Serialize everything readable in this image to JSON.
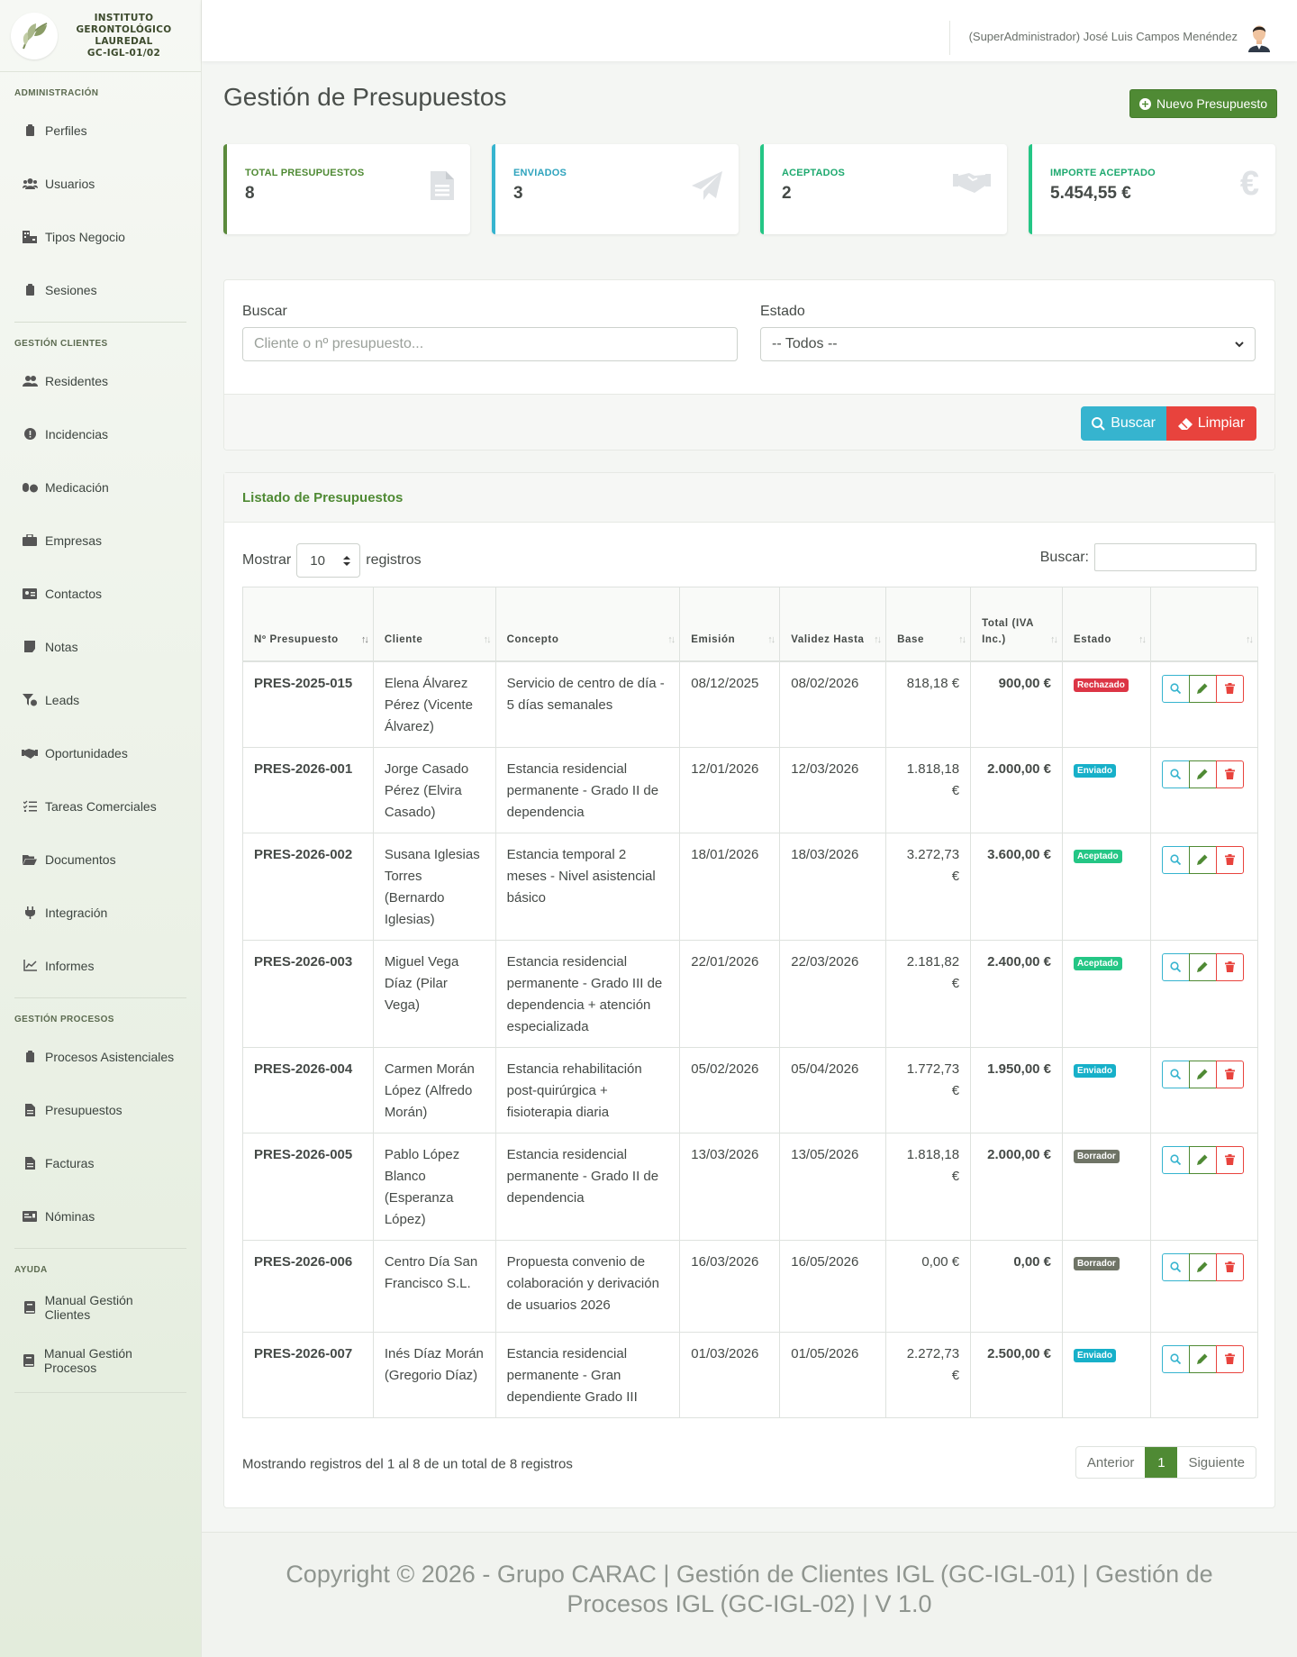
{
  "brand": {
    "line1": "INSTITUTO",
    "line2": "GERONTOLÓGICO",
    "line3": "LAUREDAL",
    "line4": "GC-IGL-01/02"
  },
  "sidebar": {
    "sections": [
      {
        "title": "Administración",
        "items": [
          "Perfiles",
          "Usuarios",
          "Tipos Negocio",
          "Sesiones"
        ]
      },
      {
        "title": "Gestión Clientes",
        "items": [
          "Residentes",
          "Incidencias",
          "Medicación",
          "Empresas",
          "Contactos",
          "Notas",
          "Leads",
          "Oportunidades",
          "Tareas Comerciales",
          "Documentos",
          "Integración",
          "Informes"
        ]
      },
      {
        "title": "Gestión Procesos",
        "items": [
          "Procesos Asistenciales",
          "Presupuestos",
          "Facturas",
          "Nóminas"
        ]
      },
      {
        "title": "Ayuda",
        "items": [
          "Manual Gestión Clientes",
          "Manual Gestión Procesos"
        ]
      }
    ]
  },
  "topbar": {
    "user": "(SuperAdministrador) José Luis Campos Menéndez"
  },
  "page": {
    "title": "Gestión de Presupuestos",
    "new_button": "Nuevo Presupuesto"
  },
  "stats": [
    {
      "label": "Total Presupuestos",
      "value": "8",
      "color": "#5b8a3c",
      "icon": "document-icon"
    },
    {
      "label": "Enviados",
      "value": "3",
      "color": "#36b4cf",
      "icon": "paper-plane-icon"
    },
    {
      "label": "Aceptados",
      "value": "2",
      "color": "#24c685",
      "icon": "handshake-icon"
    },
    {
      "label": "Importe Aceptado",
      "value": "5.454,55 €",
      "color": "#24c685",
      "icon": "euro-icon"
    }
  ],
  "filters": {
    "search_label": "Buscar",
    "search_placeholder": "Cliente o nº presupuesto...",
    "status_label": "Estado",
    "status_value": "-- Todos --",
    "search_button": "Buscar",
    "clear_button": "Limpiar"
  },
  "list": {
    "title": "Listado de Presupuestos",
    "show_label": "Mostrar",
    "page_size": "10",
    "records_label": "registros",
    "search_label": "Buscar:",
    "columns": [
      "Nº Presupuesto",
      "Cliente",
      "Concepto",
      "Emisión",
      "Validez Hasta",
      "Base",
      "Total (IVA Inc.)",
      "Estado"
    ],
    "rows": [
      {
        "num": "PRES-2025-015",
        "client": "Elena Álvarez Pérez (Vicente Álvarez)",
        "concept": "Servicio de centro de día - 5 días semanales",
        "issued": "08/12/2025",
        "valid": "08/02/2026",
        "base": "818,18 €",
        "total": "900,00 €",
        "status": "Rechazado",
        "status_color": "#dc3545"
      },
      {
        "num": "PRES-2026-001",
        "client": "Jorge Casado Pérez (Elvira Casado)",
        "concept": "Estancia residencial permanente - Grado II de dependencia",
        "issued": "12/01/2026",
        "valid": "12/03/2026",
        "base": "1.818,18 €",
        "total": "2.000,00 €",
        "status": "Enviado",
        "status_color": "#17b0c9"
      },
      {
        "num": "PRES-2026-002",
        "client": "Susana Iglesias Torres (Bernardo Iglesias)",
        "concept": "Estancia temporal 2 meses - Nivel asistencial básico",
        "issued": "18/01/2026",
        "valid": "18/03/2026",
        "base": "3.272,73 €",
        "total": "3.600,00 €",
        "status": "Aceptado",
        "status_color": "#24c685"
      },
      {
        "num": "PRES-2026-003",
        "client": "Miguel Vega Díaz (Pilar Vega)",
        "concept": "Estancia residencial permanente - Grado III de dependencia + atención especializada",
        "issued": "22/01/2026",
        "valid": "22/03/2026",
        "base": "2.181,82 €",
        "total": "2.400,00 €",
        "status": "Aceptado",
        "status_color": "#24c685"
      },
      {
        "num": "PRES-2026-004",
        "client": "Carmen Morán López (Alfredo Morán)",
        "concept": "Estancia rehabilitación post-quirúrgica + fisioterapia diaria",
        "issued": "05/02/2026",
        "valid": "05/04/2026",
        "base": "1.772,73 €",
        "total": "1.950,00 €",
        "status": "Enviado",
        "status_color": "#17b0c9"
      },
      {
        "num": "PRES-2026-005",
        "client": "Pablo López Blanco (Esperanza López)",
        "concept": "Estancia residencial permanente - Grado II de dependencia",
        "issued": "13/03/2026",
        "valid": "13/05/2026",
        "base": "1.818,18 €",
        "total": "2.000,00 €",
        "status": "Borrador",
        "status_color": "#6f7466"
      },
      {
        "num": "PRES-2026-006",
        "client": "Centro Día San Francisco S.L.",
        "concept": "Propuesta convenio de colaboración y derivación de usuarios 2026",
        "issued": "16/03/2026",
        "valid": "16/05/2026",
        "base": "0,00 €",
        "total": "0,00 €",
        "status": "Borrador",
        "status_color": "#6f7466"
      },
      {
        "num": "PRES-2026-007",
        "client": "Inés Díaz Morán (Gregorio Díaz)",
        "concept": "Estancia residencial permanente - Gran dependiente Grado III",
        "issued": "01/03/2026",
        "valid": "01/05/2026",
        "base": "2.272,73 €",
        "total": "2.500,00 €",
        "status": "Enviado",
        "status_color": "#17b0c9"
      }
    ],
    "info": "Mostrando registros del 1 al 8 de un total de 8 registros",
    "prev": "Anterior",
    "page": "1",
    "next": "Siguiente"
  },
  "footer": "Copyright © 2026 - Grupo CARAC | Gestión de Clientes IGL (GC-IGL-01) | Gestión de Procesos IGL (GC-IGL-02) | V 1.0",
  "colors": {
    "accent": "#4f8a34",
    "info": "#36b4cf",
    "danger": "#e8433d"
  }
}
